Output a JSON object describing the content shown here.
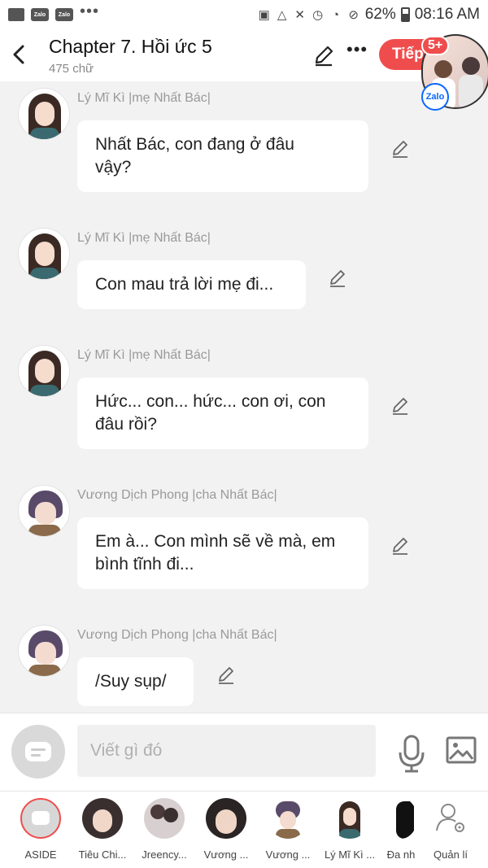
{
  "status_bar": {
    "battery": "62%",
    "time": "08:16 AM",
    "zalo_label": "Zalo"
  },
  "header": {
    "title": "Chapter 7. Hồi ức 5",
    "subtitle": "475 chữ",
    "next_button": "Tiếp",
    "badge": "5+",
    "zalo_label": "Zalo"
  },
  "messages": [
    {
      "sender": "Lý Mĩ Kì |mẹ Nhất Bác|",
      "text": "Nhất Bác, con đang ở đâu vậy?",
      "lines": [
        "Nhất Bác, con đang ở đâu",
        "vậy?"
      ],
      "avatar": "female"
    },
    {
      "sender": "Lý Mĩ Kì |mẹ Nhất Bác|",
      "text": "Con mau trả lời mẹ đi...",
      "lines": [
        "Con mau trả lời mẹ đi..."
      ],
      "avatar": "female"
    },
    {
      "sender": "Lý Mĩ Kì |mẹ Nhất Bác|",
      "text": "Hức... con... hức... con ơi, con đâu rồi?",
      "lines": [
        "Hức... con... hức... con ơi, con",
        "đâu rồi?"
      ],
      "avatar": "female"
    },
    {
      "sender": "Vương Dịch Phong |cha Nhất Bác|",
      "text": "Em à... Con mình sẽ về mà, em bình tĩnh đi...",
      "lines": [
        "Em à... Con mình sẽ về mà, em",
        "bình tĩnh đi..."
      ],
      "avatar": "male"
    },
    {
      "sender": "Vương Dịch Phong |cha Nhất Bác|",
      "text": "/Suy sụp/",
      "lines": [
        "/Suy sụp/"
      ],
      "avatar": "male"
    }
  ],
  "composer": {
    "placeholder": "Viết gì đó"
  },
  "characters": [
    {
      "label": "ASIDE"
    },
    {
      "label": "Tiêu Chi..."
    },
    {
      "label": "Jreency..."
    },
    {
      "label": "Vương ..."
    },
    {
      "label": "Vương ..."
    },
    {
      "label": "Lý Mĩ Kì ..."
    },
    {
      "label": "Đa nh"
    },
    {
      "label": "Quản lí"
    }
  ],
  "colors": {
    "accent": "#ef4d4d",
    "zalo_blue": "#0a68ff",
    "background": "#f2f2f2"
  }
}
